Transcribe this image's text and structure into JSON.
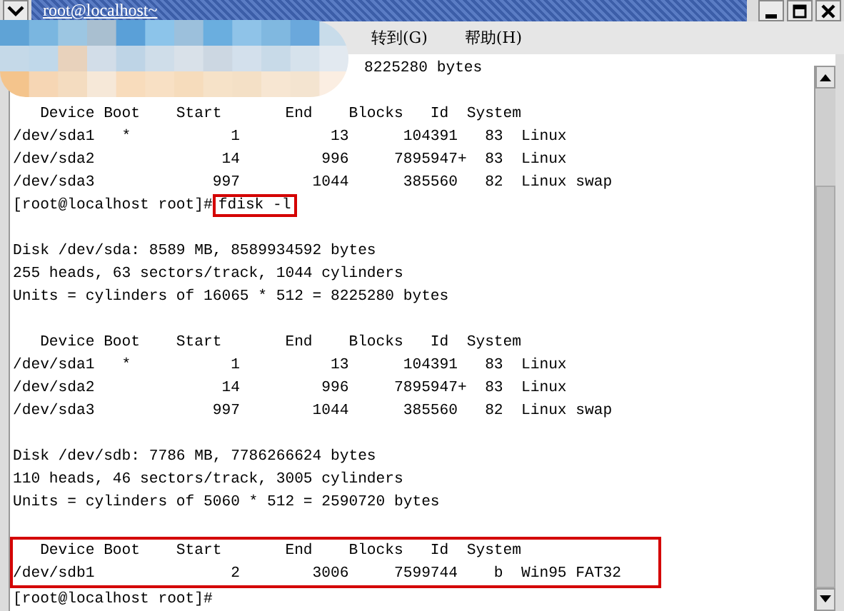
{
  "window": {
    "title": "root@localhost~"
  },
  "menu": [
    "转到(G)",
    "帮助(H)"
  ],
  "terminal": {
    "lines": [
      {
        "kind": "partial",
        "text": "8225280 bytes"
      },
      {
        "kind": "blank"
      },
      {
        "kind": "text",
        "text": "   Device Boot    Start       End    Blocks   Id  System"
      },
      {
        "kind": "text",
        "text": "/dev/sda1   *           1          13      104391   83  Linux"
      },
      {
        "kind": "text",
        "text": "/dev/sda2              14         996     7895947+  83  Linux"
      },
      {
        "kind": "text",
        "text": "/dev/sda3             997        1044      385560   82  Linux swap"
      },
      {
        "kind": "prompt",
        "prompt": "[root@localhost root]#",
        "command": "fdisk -l",
        "highlighted": true
      },
      {
        "kind": "blank"
      },
      {
        "kind": "text",
        "text": "Disk /dev/sda: 8589 MB, 8589934592 bytes"
      },
      {
        "kind": "text",
        "text": "255 heads, 63 sectors/track, 1044 cylinders"
      },
      {
        "kind": "text",
        "text": "Units = cylinders of 16065 * 512 = 8225280 bytes"
      },
      {
        "kind": "blank"
      },
      {
        "kind": "text",
        "text": "   Device Boot    Start       End    Blocks   Id  System"
      },
      {
        "kind": "text",
        "text": "/dev/sda1   *           1          13      104391   83  Linux"
      },
      {
        "kind": "text",
        "text": "/dev/sda2              14         996     7895947+  83  Linux"
      },
      {
        "kind": "text",
        "text": "/dev/sda3             997        1044      385560   82  Linux swap"
      },
      {
        "kind": "blank"
      },
      {
        "kind": "text",
        "text": "Disk /dev/sdb: 7786 MB, 7786266624 bytes"
      },
      {
        "kind": "text",
        "text": "110 heads, 46 sectors/track, 3005 cylinders"
      },
      {
        "kind": "text",
        "text": "Units = cylinders of 5060 * 512 = 2590720 bytes"
      },
      {
        "kind": "blank"
      },
      {
        "kind": "boxed",
        "lines": [
          {
            "kind": "text",
            "text": "   Device Boot    Start       End    Blocks   Id  System"
          },
          {
            "kind": "text",
            "text": "/dev/sdb1               2        3006     7599744    b  Win95 FAT32"
          }
        ]
      },
      {
        "kind": "prompt",
        "prompt": "[root@localhost root]#"
      }
    ]
  }
}
